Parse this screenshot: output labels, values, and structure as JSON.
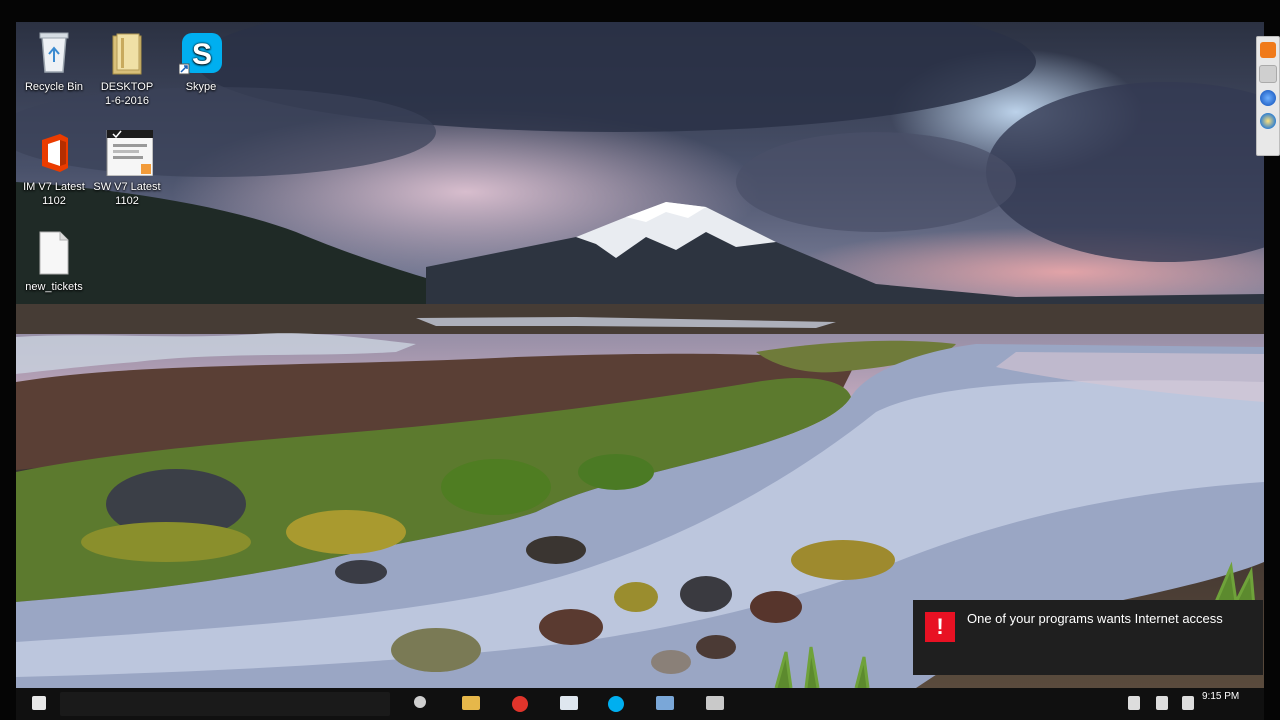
{
  "desktop_icons": [
    {
      "label": "Recycle Bin",
      "icon": "recycle-bin-icon"
    },
    {
      "label": "DESKTOP 1-6-2016",
      "line1": "DESKTOP",
      "line2": "1-6-2016",
      "icon": "folder-icon"
    },
    {
      "label": "Skype",
      "icon": "skype-icon"
    },
    {
      "label": "IM V7 Latest 1102",
      "line1": "IM V7 Latest",
      "line2": "1102",
      "icon": "office-icon"
    },
    {
      "label": "SW V7 Latest 1102",
      "line1": "SW V7 Latest",
      "line2": "1102",
      "icon": "document-shortcut-icon"
    },
    {
      "label": "new_tickets",
      "icon": "blank-file-icon"
    }
  ],
  "notification": {
    "icon": "alert-icon",
    "alert_glyph": "!",
    "message": "One of your programs wants Internet access"
  },
  "taskbar": {
    "clock": "9:15 PM",
    "pinned": [
      "start-button-icon",
      "search-icon",
      "file-explorer-icon",
      "browser-icon",
      "store-icon",
      "skype-icon",
      "settings-icon",
      "app-icon"
    ]
  },
  "side_toolbar": [
    "mail-icon",
    "scroll-icon",
    "globe-icon",
    "globe-icon"
  ],
  "colors": {
    "accent_alert": "#e81123",
    "skype": "#00aff0",
    "office": "#eb3c00",
    "taskbar": "#101010"
  }
}
